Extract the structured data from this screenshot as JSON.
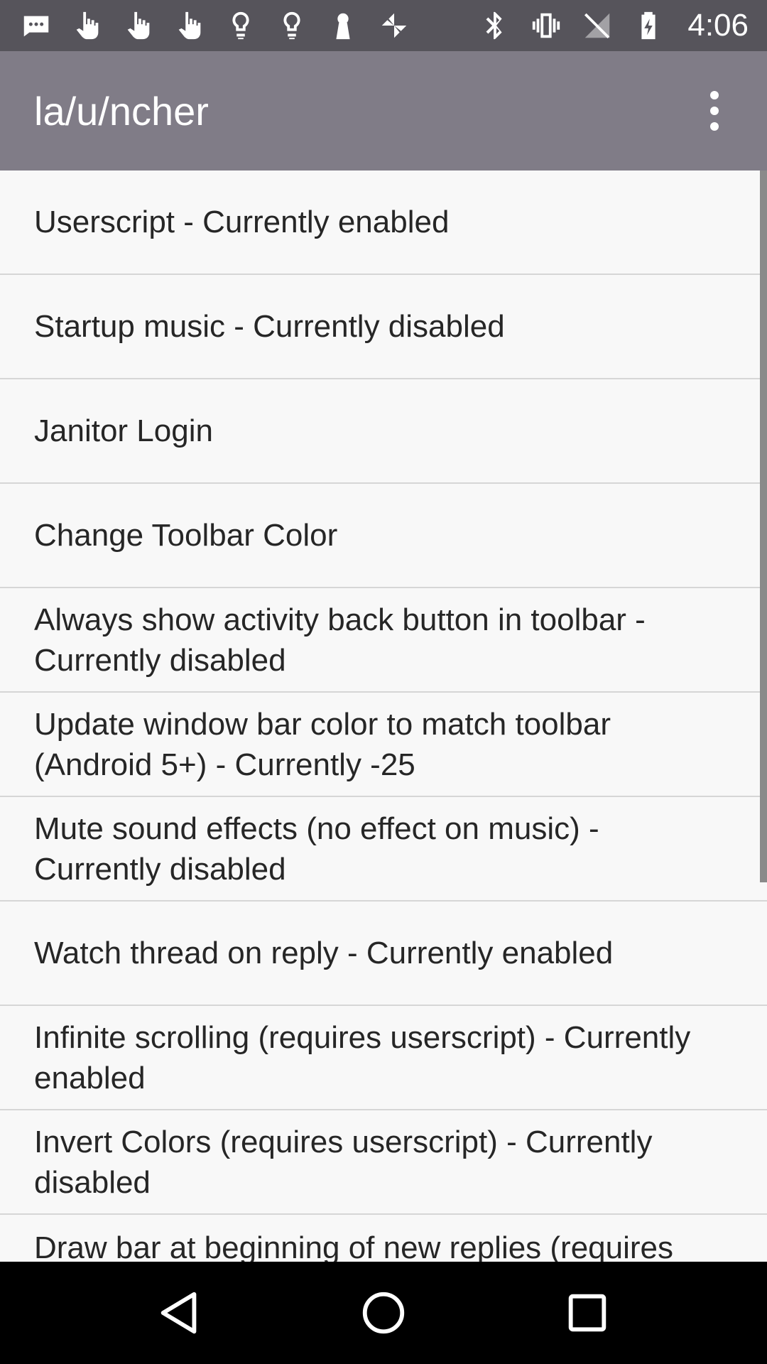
{
  "status_bar": {
    "left_icons": [
      "message-icon",
      "hand-pointer-icon",
      "hand-pointer-icon",
      "hand-pointer-icon",
      "lightbulb-icon",
      "lightbulb-icon",
      "keyhole-icon",
      "pinwheel-icon"
    ],
    "right_icons": [
      "bluetooth-icon",
      "vibrate-icon",
      "no-signal-icon",
      "battery-charging-icon"
    ],
    "time": "4:06"
  },
  "toolbar": {
    "title": "la/u/ncher",
    "menu_icon": "overflow-menu-icon"
  },
  "settings": [
    {
      "label": "Userscript - Currently enabled"
    },
    {
      "label": "Startup music - Currently disabled"
    },
    {
      "label": "Janitor Login"
    },
    {
      "label": "Change Toolbar Color"
    },
    {
      "label": "Always show activity back button in toolbar - Currently disabled"
    },
    {
      "label": "Update window bar color to match toolbar (Android 5+) - Currently -25"
    },
    {
      "label": "Mute sound effects (no effect on music) - Currently disabled"
    },
    {
      "label": "Watch thread on reply - Currently enabled"
    },
    {
      "label": "Infinite scrolling (requires userscript) - Currently enabled"
    },
    {
      "label": "Invert Colors (requires userscript) - Currently disabled"
    },
    {
      "label": "Draw bar at beginning of new replies (requires"
    }
  ],
  "nav_bar": {
    "buttons": [
      "back-icon",
      "home-icon",
      "recents-icon"
    ]
  },
  "colors": {
    "status_bar": "#56545b",
    "toolbar": "#807c87",
    "list_background": "#f8f8f8",
    "divider": "#d6d6d6"
  }
}
